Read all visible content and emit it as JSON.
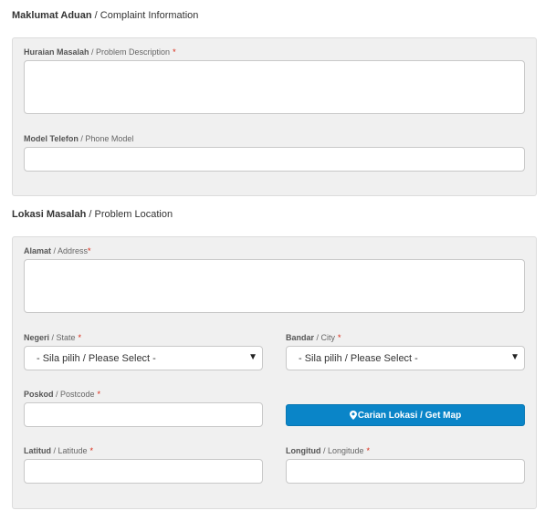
{
  "complaint": {
    "heading_bm": "Maklumat Aduan",
    "heading_en": " / Complaint Information",
    "problem_desc": {
      "label_bm": "Huraian Masalah",
      "label_en": " / Problem Description",
      "required": "*",
      "value": ""
    },
    "phone_model": {
      "label_bm": "Model Telefon",
      "label_en": " / Phone Model",
      "value": ""
    }
  },
  "location": {
    "heading_bm": "Lokasi Masalah",
    "heading_en": " / Problem Location",
    "address": {
      "label_bm": "Alamat",
      "label_en": " / Address",
      "required": "*",
      "value": ""
    },
    "state": {
      "label_bm": "Negeri",
      "label_en": " / State",
      "required": "*",
      "selected": "- Sila pilih / Please Select -"
    },
    "city": {
      "label_bm": "Bandar",
      "label_en": " / City",
      "required": "*",
      "selected": "- Sila pilih / Please Select -"
    },
    "postcode": {
      "label_bm": "Poskod",
      "label_en": " / Postcode",
      "required": "*",
      "value": ""
    },
    "get_map_button": {
      "label": "Carian Lokasi / Get Map",
      "icon": "map-marker-icon"
    },
    "latitude": {
      "label_bm": "Latitud",
      "label_en": " / Latitude",
      "required": "*",
      "value": ""
    },
    "longitude": {
      "label_bm": "Longitud",
      "label_en": " / Longitude",
      "required": "*",
      "value": ""
    }
  },
  "colors": {
    "button_primary": "#0a85c8",
    "required_marker": "#d9230f",
    "well_background": "#f0f0f0"
  }
}
